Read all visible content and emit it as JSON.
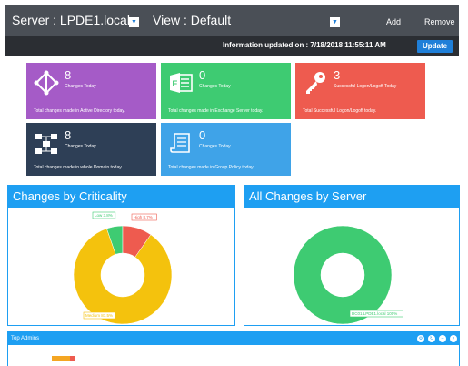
{
  "toolbar": {
    "server_label": "Server : LPDE1.local",
    "view_label": "View : Default",
    "add_label": "Add",
    "remove_label": "Remove",
    "info_text": "Information updated on : 7/18/2018 11:55:11 AM",
    "update_label": "Update"
  },
  "tiles": [
    {
      "count": "8",
      "sub": "Changes Today",
      "desc": "Total changes made in Active Directory today.",
      "color": "#a55bc7",
      "icon": "active-directory-icon"
    },
    {
      "count": "0",
      "sub": "Changes Today",
      "desc": "Total changes made in Exchange Server today.",
      "color": "#3ecb72",
      "icon": "exchange-icon"
    },
    {
      "count": "3",
      "sub": "Successful Logon/Logoff Today",
      "desc": "Total Successful Logon/Logoff today.",
      "color": "#ee5b4f",
      "icon": "key-icon"
    },
    {
      "count": "8",
      "sub": "Changes Today",
      "desc": "Total changes made in whole Domain today.",
      "color": "#2e3f56",
      "icon": "domain-icon"
    },
    {
      "count": "0",
      "sub": "Changes Today",
      "desc": "Total changes made in Group Policy today.",
      "color": "#3fa3e8",
      "icon": "group-policy-icon"
    }
  ],
  "panels": {
    "criticality_title": "Changes by Criticality",
    "server_title": "All Changes by Server",
    "admins_title": "Top Admins"
  },
  "chart_data": [
    {
      "type": "pie",
      "title": "Changes by Criticality",
      "categories": [
        "Medium",
        "High",
        "Low"
      ],
      "values": [
        85.0,
        9.7,
        5.3
      ],
      "labels": [
        "Medium 87.5%",
        "High 8.7%",
        "Low 3.8%"
      ],
      "colors": [
        "#f4c20d",
        "#ee5b4f",
        "#3ecb72"
      ]
    },
    {
      "type": "pie",
      "title": "All Changes by Server",
      "categories": [
        "DC01.LPDE1.local"
      ],
      "values": [
        100
      ],
      "labels": [
        "DC01.LPDE1.local 100%"
      ],
      "colors": [
        "#3ecb72"
      ]
    }
  ]
}
